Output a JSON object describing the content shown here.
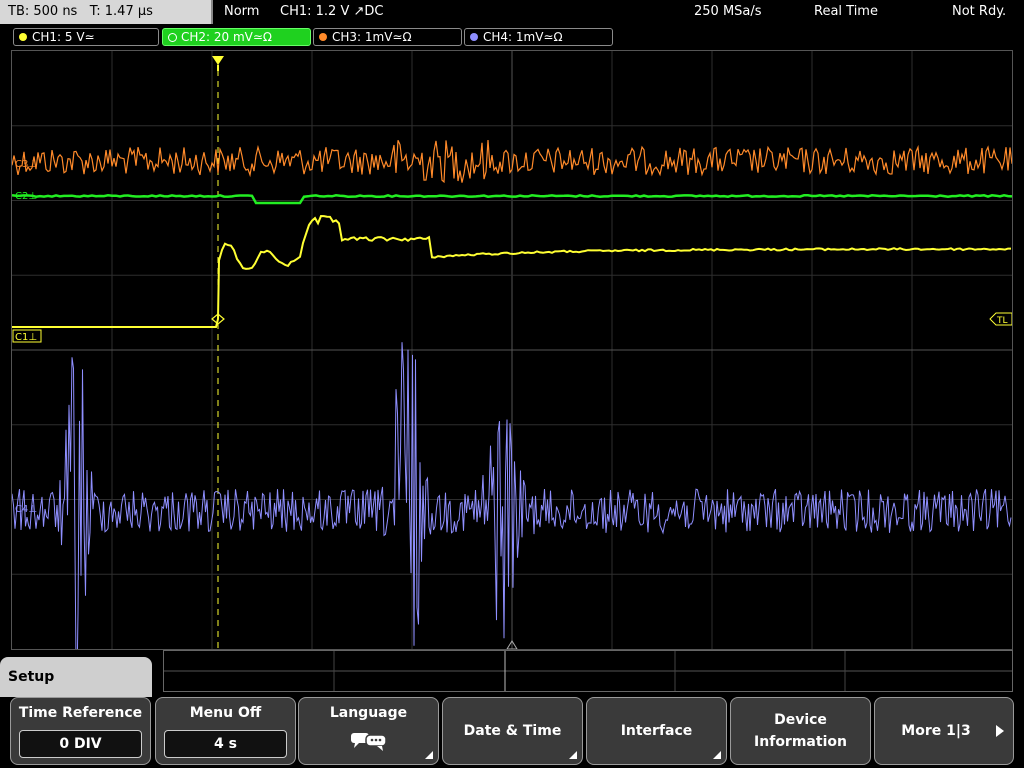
{
  "status": {
    "timebase": "TB: 500 ns",
    "trigger_time": "T: 1.47 µs",
    "mode": "Norm",
    "trigger_setting": "CH1: 1.2 V ↗DC",
    "sample_rate": "250 MSa/s",
    "acq_mode": "Real Time",
    "state": "Not Rdy."
  },
  "channels": [
    {
      "label": "CH1: 5 V≃",
      "color": "#ffff33"
    },
    {
      "label": "CH2: 20 mV≃Ω",
      "color": "#22ee22"
    },
    {
      "label": "CH3: 1mV≃Ω",
      "color": "#ff8a2a"
    },
    {
      "label": "CH4: 1mV≃Ω",
      "color": "#8f8fff"
    }
  ],
  "markers": {
    "c1": "C1⊥",
    "c2": "C2⊥",
    "c3": "C3⊥",
    "c4": "C4⊥",
    "trigger_level": "TL"
  },
  "menu": {
    "title": "Setup",
    "keys": [
      {
        "label": "Time Reference",
        "value": "0 DIV"
      },
      {
        "label": "Menu Off",
        "value": "4 s"
      },
      {
        "label": "Language"
      },
      {
        "label": "Date & Time"
      },
      {
        "label": "Interface"
      },
      {
        "label": "Device",
        "label2": "Information"
      },
      {
        "label": "More 1|3"
      }
    ]
  },
  "icons": {
    "language": "chat-bubbles-icon",
    "more": "arrow-right-icon",
    "trigger": "trigger-position-icon"
  }
}
